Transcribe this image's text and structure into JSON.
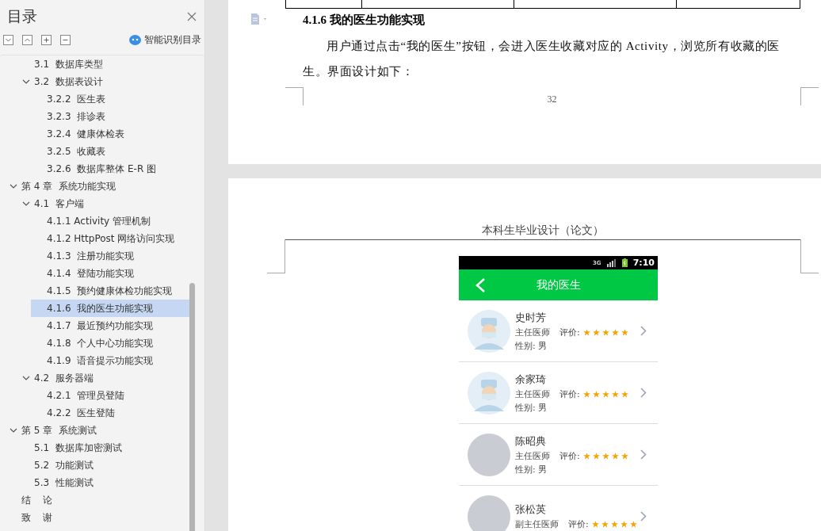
{
  "sidebar": {
    "title": "目录",
    "smart_label": "智能识别目录",
    "toc_continued": [
      {
        "label": "3.1  数据库类型",
        "selected": false
      },
      {
        "label": "3.2  数据表设计",
        "selected": false,
        "expanded": true,
        "children": [
          {
            "label": "3.2.2  医生表",
            "selected": false
          },
          {
            "label": "3.2.3  排诊表",
            "selected": false
          },
          {
            "label": "3.2.4  健康体检表",
            "selected": false
          },
          {
            "label": "3.2.5  收藏表",
            "selected": false
          },
          {
            "label": "3.2.6  数据库整体 E-R 图",
            "selected": false
          }
        ]
      }
    ],
    "toc": [
      {
        "label": "第 4 章  系统功能实现",
        "selected": false,
        "expanded": true,
        "children": [
          {
            "label": "4.1  客户端",
            "selected": false,
            "expanded": true,
            "children": [
              {
                "label": "4.1.1 Activity 管理机制",
                "selected": false
              },
              {
                "label": "4.1.2 HttpPost 网络访问实现",
                "selected": false
              },
              {
                "label": "4.1.3  注册功能实现",
                "selected": false
              },
              {
                "label": "4.1.4  登陆功能实现",
                "selected": false
              },
              {
                "label": "4.1.5  预约健康体检功能实现",
                "selected": false
              },
              {
                "label": "4.1.6  我的医生功能实现",
                "selected": true
              },
              {
                "label": "4.1.7  最近预约功能实现",
                "selected": false
              },
              {
                "label": "4.1.8  个人中心功能实现",
                "selected": false
              },
              {
                "label": "4.1.9  语音提示功能实现",
                "selected": false
              }
            ]
          },
          {
            "label": "4.2  服务器端",
            "selected": false,
            "expanded": true,
            "children": [
              {
                "label": "4.2.1  管理员登陆",
                "selected": false
              },
              {
                "label": "4.2.2  医生登陆",
                "selected": false
              }
            ]
          }
        ]
      },
      {
        "label": "第 5 章  系统测试",
        "selected": false,
        "expanded": true,
        "children": [
          {
            "label": "5.1  数据库加密测试",
            "selected": false
          },
          {
            "label": "5.2  功能测试",
            "selected": false
          },
          {
            "label": "5.3  性能测试",
            "selected": false
          }
        ]
      },
      {
        "label": "结    论",
        "selected": false
      },
      {
        "label": "致    谢",
        "selected": false
      }
    ]
  },
  "page_1": {
    "heading": "4.1.6  我的医生功能实现",
    "paragraph": "用户通过点击“我的医生”按钮，会进入医生收藏对应的 Activity，浏览所有收藏的医生。界面设计如下：",
    "page_number": "32"
  },
  "page_2": {
    "header": "本科生毕业设计（论文）",
    "phone": {
      "time": "7:10",
      "network": "3G",
      "title": "我的医生",
      "doctors": [
        {
          "name": "史时芳",
          "title": "主任医师",
          "rating_label": "评价:",
          "stars": 5,
          "gender": "性别: 男",
          "kind": "illustration"
        },
        {
          "name": "余家琦",
          "title": "主任医师",
          "rating_label": "评价:",
          "stars": 5,
          "gender": "性别: 男",
          "kind": "illustration"
        },
        {
          "name": "陈昭典",
          "title": "主任医师",
          "rating_label": "评价:",
          "stars": 5,
          "gender": "性别: 男",
          "kind": "photo"
        },
        {
          "name": "张松英",
          "title": "副主任医师",
          "rating_label": "评价:",
          "stars": 5,
          "kind": "photo"
        }
      ]
    }
  }
}
